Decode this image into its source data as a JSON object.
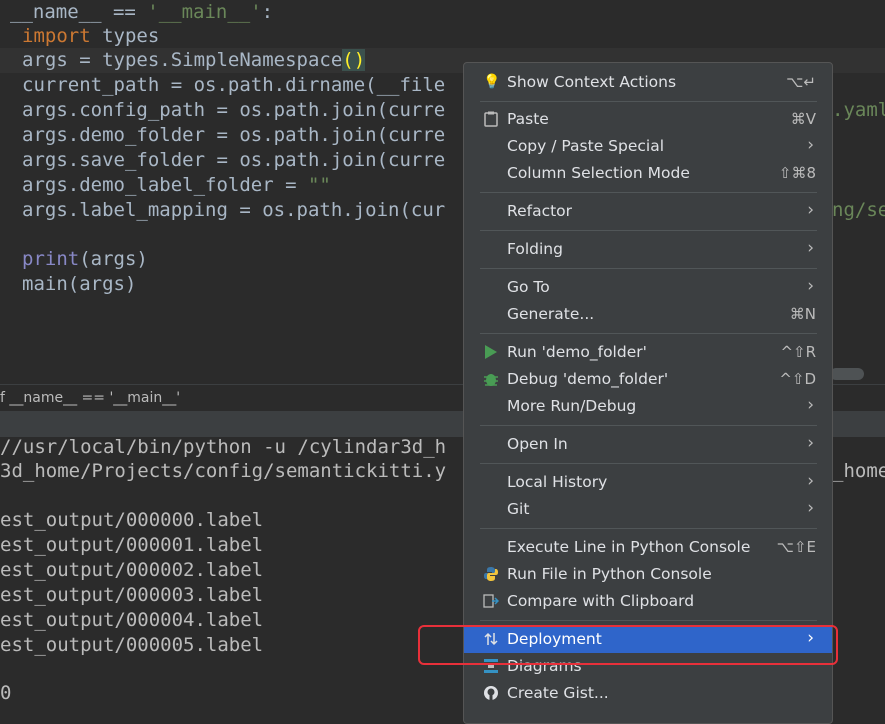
{
  "editor": {
    "lines": [
      {
        "p1": "__name__ == ",
        "str": "'__main__'",
        "p2": ":"
      },
      {
        "kw": "import",
        "rest": " types"
      },
      {
        "pre": "args = types.SimpleNamespace",
        "paren": "()"
      },
      {
        "text": "current_path = os.path.dirname(__file"
      },
      {
        "text": "args.config_path = os.path.join(curre"
      },
      {
        "text": "args.demo_folder = os.path.join(curre"
      },
      {
        "text": "args.save_folder = os.path.join(curre"
      },
      {
        "pre": "args.demo_label_folder = ",
        "str": "\"\""
      },
      {
        "text": "args.label_mapping = os.path.join(cur"
      },
      {
        "fn": "print",
        "rest": "(args)"
      },
      {
        "text": "main(args)"
      }
    ],
    "right_overflow": [
      ".yaml",
      "ng/se"
    ]
  },
  "breadcrumb": "f __name__ == '__main__'",
  "console": {
    "lines": [
      "//usr/local/bin/python -u /cylindar3d_h",
      "3d_home/Projects/config/semantickitti.y",
      "est_output/000000.label",
      "est_output/000001.label",
      "est_output/000002.label",
      "est_output/000003.label",
      "est_output/000004.label",
      "est_output/000005.label",
      "0"
    ],
    "right_overflow": "_home"
  },
  "context_menu": {
    "items": [
      {
        "label": "Show Context Actions",
        "shortcut": "⌥↵",
        "icon": "bulb-icon"
      },
      {
        "label": "Paste",
        "shortcut": "⌘V",
        "icon": "clipboard-icon"
      },
      {
        "label": "Copy / Paste Special",
        "submenu": true
      },
      {
        "label": "Column Selection Mode",
        "shortcut": "⇧⌘8"
      },
      {
        "label": "Refactor",
        "submenu": true
      },
      {
        "label": "Folding",
        "submenu": true
      },
      {
        "label": "Go To",
        "submenu": true
      },
      {
        "label": "Generate...",
        "shortcut": "⌘N"
      },
      {
        "label": "Run 'demo_folder'",
        "shortcut": "^⇧R",
        "icon": "run-icon"
      },
      {
        "label": "Debug 'demo_folder'",
        "shortcut": "^⇧D",
        "icon": "debug-icon"
      },
      {
        "label": "More Run/Debug",
        "submenu": true
      },
      {
        "label": "Open In",
        "submenu": true
      },
      {
        "label": "Local History",
        "submenu": true
      },
      {
        "label": "Git",
        "submenu": true
      },
      {
        "label": "Execute Line in Python Console",
        "shortcut": "⌥⇧E"
      },
      {
        "label": "Run File in Python Console",
        "icon": "python-icon"
      },
      {
        "label": "Compare with Clipboard",
        "icon": "compare-icon"
      },
      {
        "label": "Deployment",
        "submenu": true,
        "selected": true,
        "icon": "deployment-icon"
      },
      {
        "label": "Diagrams",
        "icon": "diagram-icon"
      },
      {
        "label": "Create Gist...",
        "icon": "github-icon"
      }
    ]
  },
  "colors": {
    "menu_bg": "#3c3f41",
    "selection": "#2f65ca",
    "highlight_box": "#e8303a",
    "editor_bg": "#2b2b2b"
  }
}
